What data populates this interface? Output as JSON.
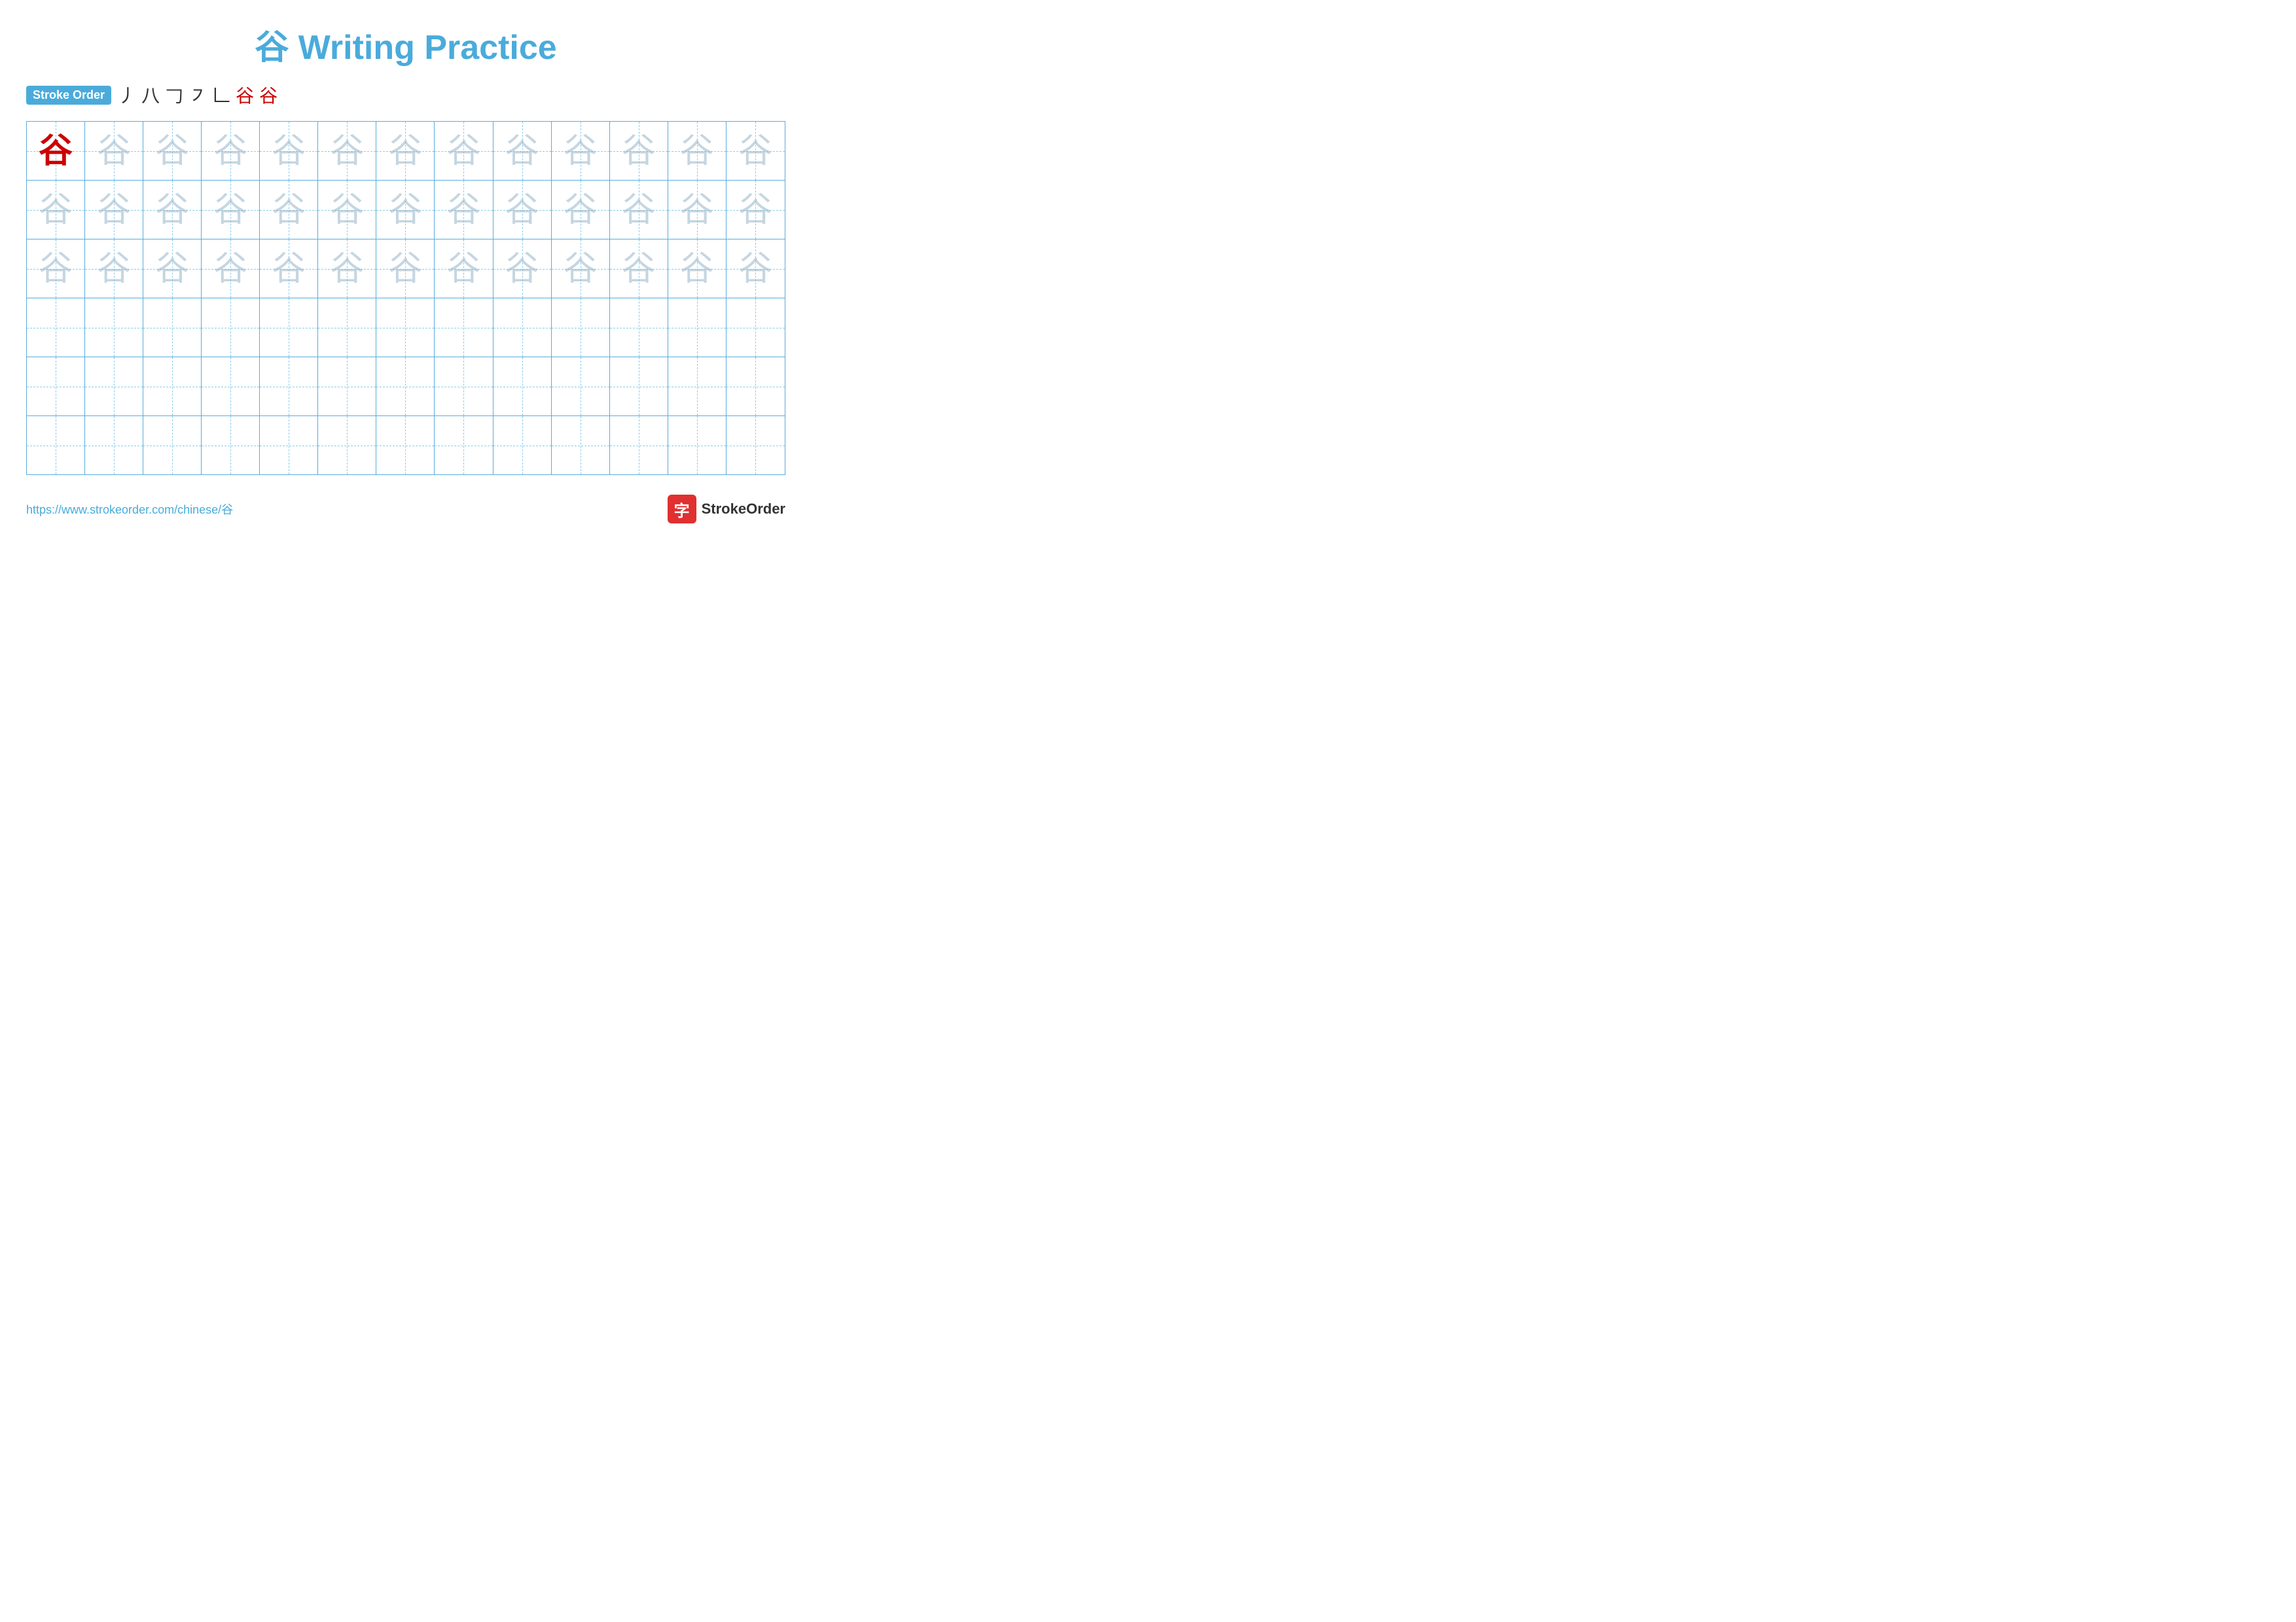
{
  "title": "谷 Writing Practice",
  "stroke_order": {
    "label": "Stroke Order",
    "strokes": [
      "丿",
      "八",
      "𠃌",
      "㇇",
      "𠃊",
      "谷",
      "谷"
    ]
  },
  "character": "谷",
  "grid": {
    "rows": 6,
    "cols": 13,
    "row1_solid_index": 0,
    "faded_rows": [
      0,
      1,
      2
    ],
    "empty_rows": [
      3,
      4,
      5
    ]
  },
  "footer": {
    "url": "https://www.strokeorder.com/chinese/谷",
    "logo_text": "StrokeOrder",
    "logo_char": "字"
  }
}
